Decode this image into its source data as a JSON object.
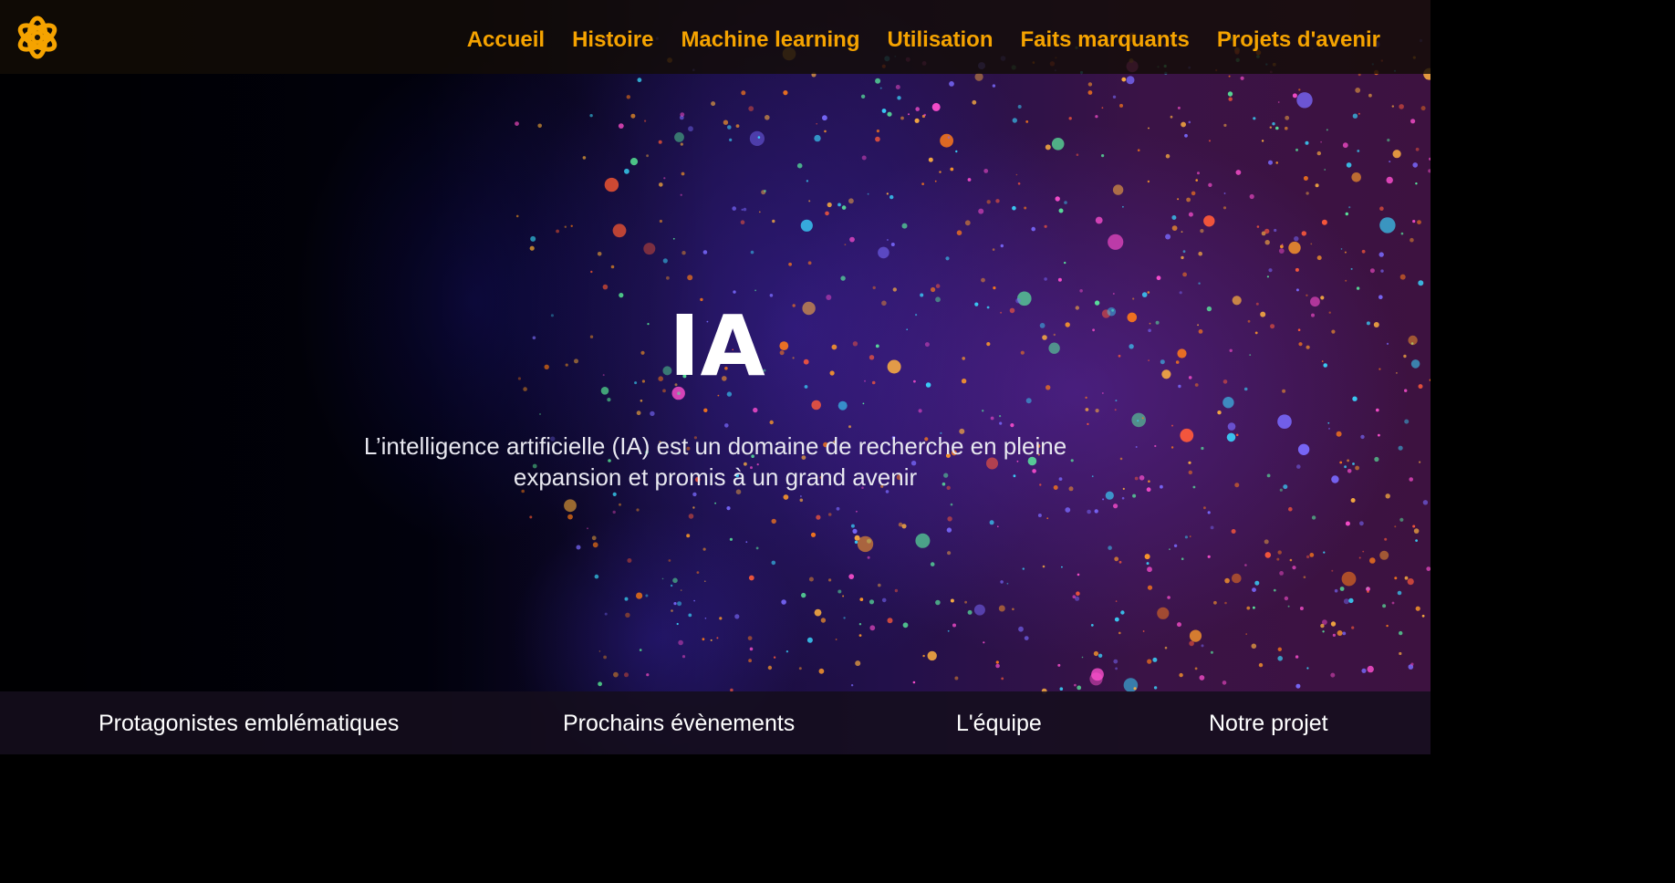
{
  "brand": {
    "logo_icon": "atom-flower-icon",
    "accent_color": "#f5a300"
  },
  "nav": {
    "items": [
      {
        "label": "Accueil"
      },
      {
        "label": "Histoire"
      },
      {
        "label": "Machine learning"
      },
      {
        "label": "Utilisation"
      },
      {
        "label": "Faits marquants"
      },
      {
        "label": "Projets d'avenir"
      }
    ]
  },
  "hero": {
    "title": "IA",
    "subtitle": "L’intelligence artificielle (IA) est un domaine de recherche en pleine expansion et promis à un grand avenir",
    "background_image": "neon-paint-face-photo"
  },
  "footer_nav": {
    "items": [
      {
        "label": "Protagonistes emblématiques"
      },
      {
        "label": "Prochains évènements"
      },
      {
        "label": "L'équipe"
      },
      {
        "label": "Notre projet"
      }
    ]
  }
}
